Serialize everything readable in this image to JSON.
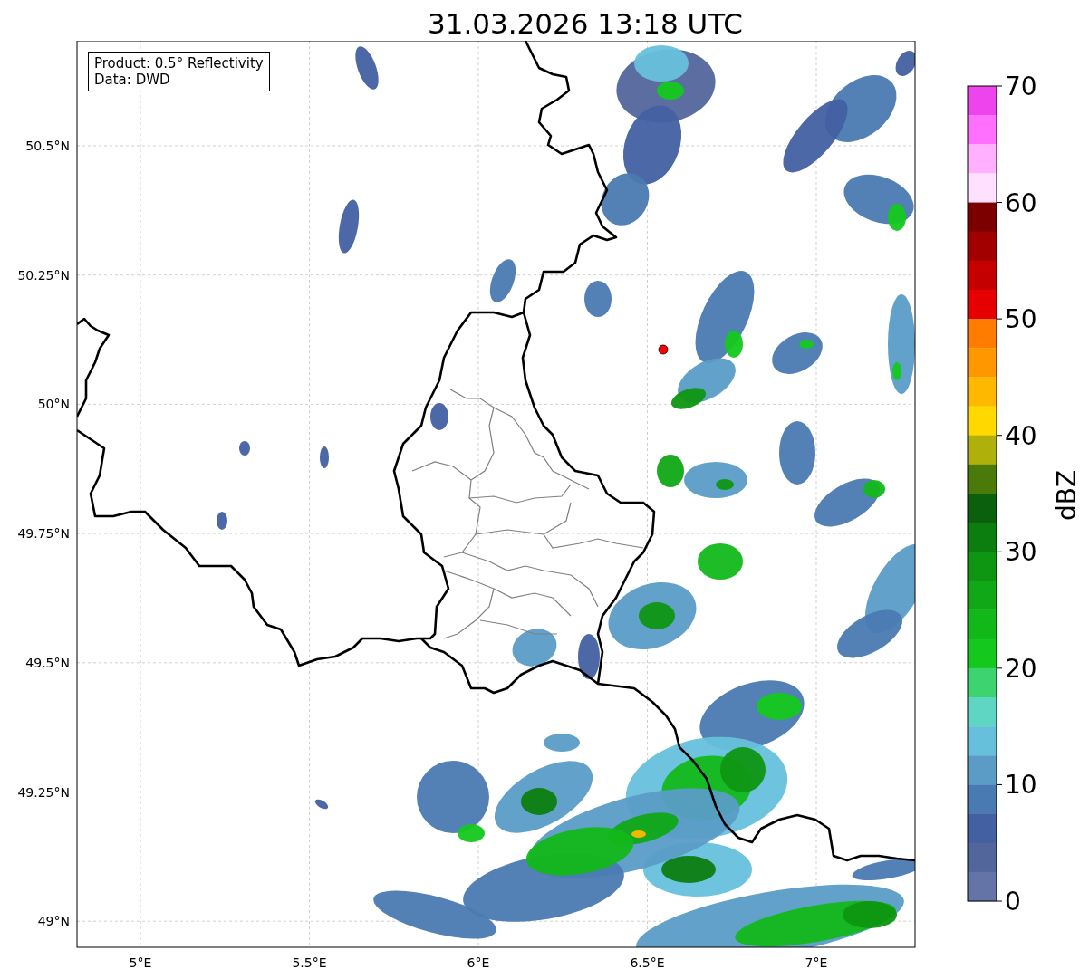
{
  "title": "31.03.2026 13:18 UTC",
  "map": {
    "info_box": [
      "Product: 0.5° Reflectivity",
      "Data: DWD"
    ],
    "lat_labels": [
      "50.5°N",
      "50.25°N",
      "50°N",
      "49.75°N",
      "49.5°N",
      "49.25°N",
      "49°N"
    ],
    "lon_labels": [
      "5°E",
      "5.5°E",
      "6°E",
      "6.5°E",
      "7°E"
    ]
  },
  "colorbar": {
    "label": "dBZ",
    "ticks": [
      "70",
      "60",
      "50",
      "40",
      "30",
      "20",
      "10",
      "0"
    ],
    "bands": [
      {
        "color": "#ee44ee"
      },
      {
        "color": "#ff70ff"
      },
      {
        "color": "#ffb0ff"
      },
      {
        "color": "#ffe0ff"
      },
      {
        "color": "#7c0000"
      },
      {
        "color": "#a00000"
      },
      {
        "color": "#c40000"
      },
      {
        "color": "#e60000"
      },
      {
        "color": "#ff7c00"
      },
      {
        "color": "#ff9800"
      },
      {
        "color": "#ffb800"
      },
      {
        "color": "#ffd800"
      },
      {
        "color": "#b0b00a"
      },
      {
        "color": "#4a7a0a"
      },
      {
        "color": "#0a600c"
      },
      {
        "color": "#0c7e10"
      },
      {
        "color": "#0e9612"
      },
      {
        "color": "#10a816"
      },
      {
        "color": "#12b81a"
      },
      {
        "color": "#14c81e"
      },
      {
        "color": "#3dd470"
      },
      {
        "color": "#5fd6c4"
      },
      {
        "color": "#66c0dc"
      },
      {
        "color": "#5a9cc6"
      },
      {
        "color": "#4a7ab2"
      },
      {
        "color": "#4360a2"
      },
      {
        "color": "#53669c"
      },
      {
        "color": "#6474a6"
      }
    ]
  }
}
